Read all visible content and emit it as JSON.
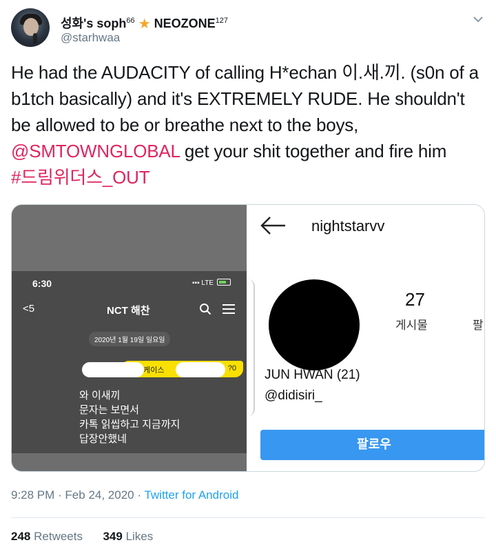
{
  "author": {
    "display_name": "성화's soph",
    "name_superscript": "66",
    "star_glyph": "★",
    "group_name": "NEOZONE",
    "group_superscript": "127",
    "handle": "@starhwaa"
  },
  "tweet": {
    "text_1": "He had the AUDACITY of calling H*echan 이.새.끼. (s0n of a b1tch basically) and it's EXTREMELY RUDE. He shouldn't be allowed to be or breathe next to the boys,",
    "mention": "@SMTOWNGLOBAL",
    "text_2": " get your shit together and fire him",
    "hashtag": "#드림위더스_OUT"
  },
  "chat_screenshot": {
    "time": "6:30",
    "status": "LTE",
    "back_count": "5",
    "chat_title": "NCT 해찬",
    "date_label": "2020년 1월 19일 일요일",
    "quote_start": "찬 케이스",
    "quote_end": "?0",
    "message_lines": [
      "와 이새끼",
      "문자는 보면서",
      "카톡 읽씹하고 지금까지",
      "답장안했네"
    ]
  },
  "instagram_screenshot": {
    "back_arrow": "←",
    "username": "nightstarvv",
    "posts_count": "27",
    "posts_label": "게시물",
    "cut_label": "팔",
    "full_name": "JUN HWAN (21)",
    "handle": "@didisiri_",
    "follow_label": "팔로우"
  },
  "footer": {
    "time": "9:28 PM",
    "separator": " · ",
    "date": "Feb 24, 2020",
    "source": "Twitter for Android",
    "retweets_count": "248",
    "retweets_label": "Retweets",
    "likes_count": "349",
    "likes_label": "Likes"
  },
  "colors": {
    "mention": "#e0245e",
    "link": "#1da1f2",
    "follow_button": "#3897f0",
    "quote_bubble": "#f9e000"
  }
}
